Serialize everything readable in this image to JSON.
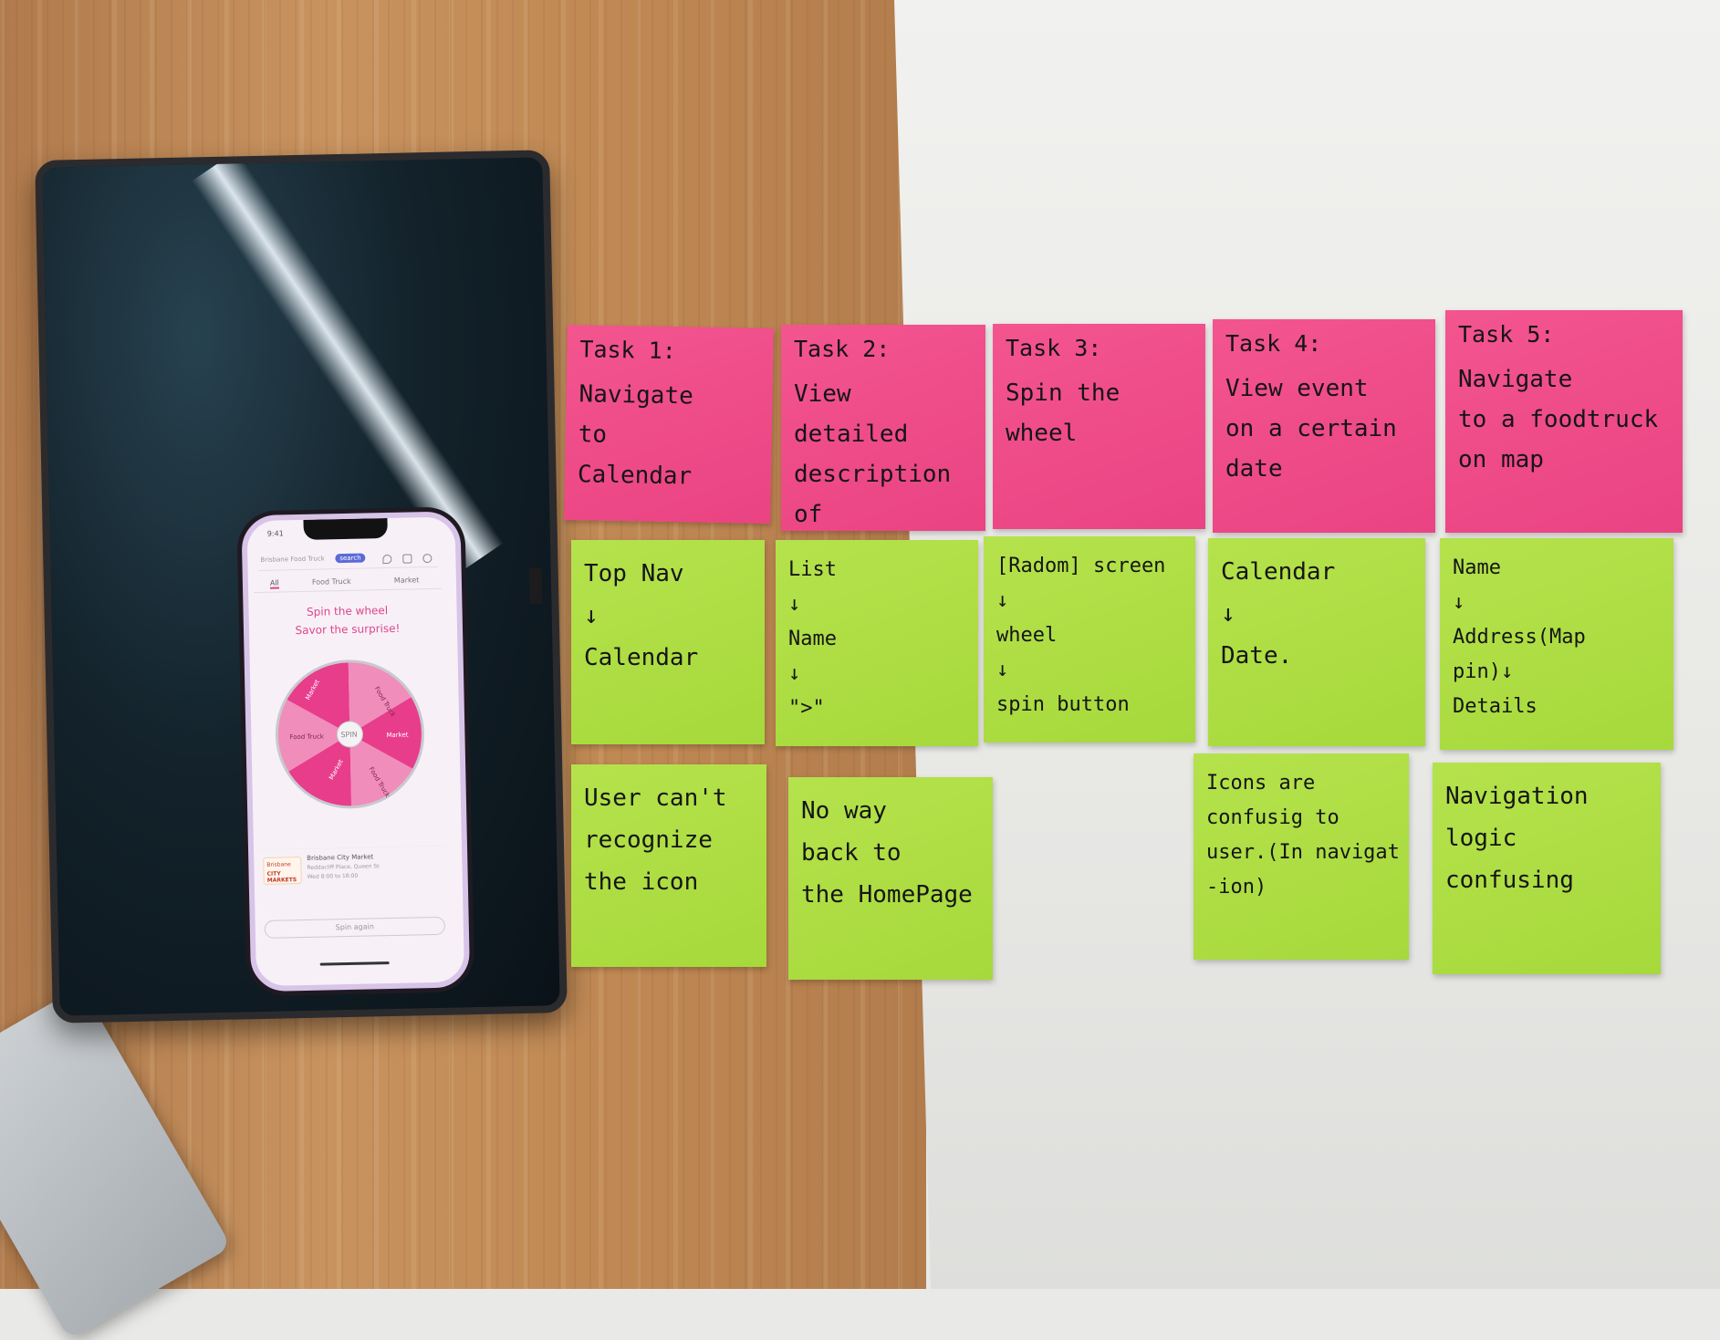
{
  "phone": {
    "clock": "9:41",
    "search_placeholder": "Brisbane Food Truck",
    "search_button": "search",
    "tabs": [
      "All",
      "Food Truck",
      "Market"
    ],
    "promo_line1": "Spin the wheel",
    "promo_line2": "Savor the surprise!",
    "wheel": {
      "center_label": "SPIN",
      "segments": [
        "Food Truck",
        "Market",
        "Food Truck",
        "Market",
        "Food Truck",
        "Market"
      ],
      "colors": [
        "#f08dbb",
        "#e83d8b",
        "#f08dbb",
        "#e83d8b",
        "#f08dbb",
        "#e83d8b"
      ]
    },
    "listing": {
      "logo_line1": "Brisbane",
      "logo_line2": "CITY MARKETS",
      "title": "Brisbane City Market",
      "address": "Reddacliff Place, Queen St",
      "hours": "Wed 8:00 to 18:00"
    },
    "spin_again": "Spin again"
  },
  "notes": {
    "task1": {
      "title": "Task 1:",
      "body": "Navigate\nto\nCalendar"
    },
    "task2": {
      "title": "Task 2:",
      "body": "View detailed\ndescription of\none food truck"
    },
    "task3": {
      "title": "Task 3:",
      "body": "Spin the\nwheel"
    },
    "task4": {
      "title": "Task 4:",
      "body": "View event\non a certain\ndate"
    },
    "task5": {
      "title": "Task 5:",
      "body": "Navigate\nto a foodtruck\non map"
    },
    "flow1": "Top Nav\n↓\nCalendar",
    "flow2": "List\n↓\nName\n↓\n\">\"",
    "flow3": "[Radom] screen\n↓\nwheel\n↓\nspin button",
    "flow4": "Calendar\n↓\nDate.",
    "flow5": "Name\n↓\nAddress(Map\npin)↓\nDetails",
    "issue1": "User can't\nrecognize\nthe icon",
    "issue2": "No way\nback to\nthe HomePage",
    "issue4": "Icons are\nconfusig to\nuser.(In navigat\n-ion)",
    "issue5": "Navigation\nlogic\nconfusing"
  },
  "colors": {
    "pink_note": "#ef4b8a",
    "green_note": "#aedd42",
    "accent": "#e0438c"
  }
}
